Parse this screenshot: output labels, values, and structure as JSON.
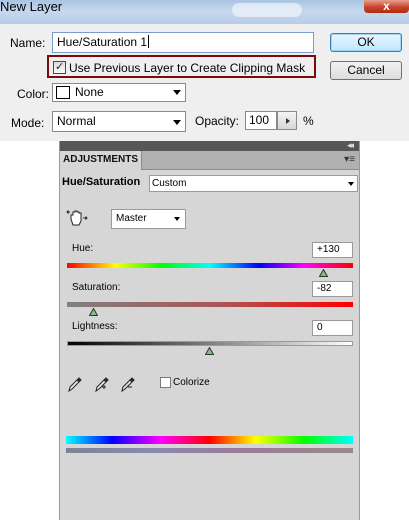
{
  "dialog": {
    "title": "New Layer",
    "close_glyph": "x",
    "name_label": "Name:",
    "name_value": "Hue/Saturation 1",
    "clip_checked": true,
    "clip_label": "Use Previous Layer to Create Clipping Mask",
    "color_label": "Color:",
    "color_value": "None",
    "mode_label": "Mode:",
    "mode_value": "Normal",
    "opacity_label": "Opacity:",
    "opacity_value": "100",
    "opacity_unit": "%",
    "ok_label": "OK",
    "cancel_label": "Cancel",
    "colors": {
      "highlight_border": "#7b0a0a",
      "ok_border": "#3c7fb1"
    }
  },
  "panel": {
    "tab_label": "ADJUSTMENTS",
    "collapse_glyph": "◂◂",
    "menu_glyph": "▾≡",
    "adjustment_name": "Hue/Saturation",
    "preset_value": "Custom",
    "tool_icon": "hand-adjust-icon",
    "channel_value": "Master",
    "hue": {
      "label": "Hue:",
      "value": "+130",
      "level": 130
    },
    "saturation": {
      "label": "Saturation:",
      "value": "-82",
      "level": -82
    },
    "lightness": {
      "label": "Lightness:",
      "value": "0",
      "level": 0
    },
    "eyedroppers": [
      "eyedropper-icon",
      "eyedropper-plus-icon",
      "eyedropper-minus-icon"
    ],
    "colorize_checked": false,
    "colorize_label": "Colorize",
    "colors": {
      "panel_bg": "#d6d6d6",
      "tab_bar": "#b0b0b0",
      "top_bar": "#565656"
    }
  }
}
